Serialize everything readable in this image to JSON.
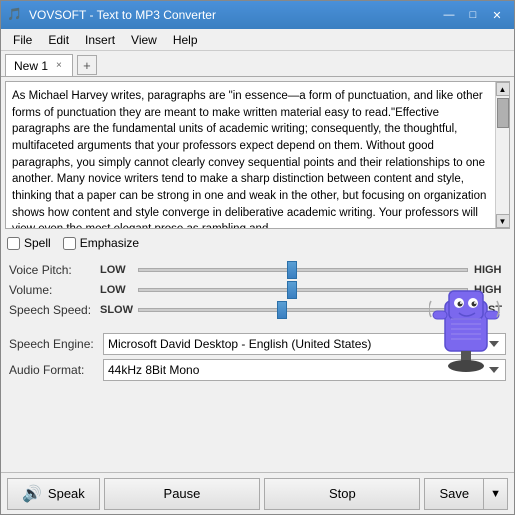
{
  "window": {
    "title": "VOVSOFT - Text to MP3 Converter",
    "icon": "🎵"
  },
  "titlebar": {
    "minimize_label": "—",
    "maximize_label": "□",
    "close_label": "✕"
  },
  "menu": {
    "items": [
      "File",
      "Edit",
      "Insert",
      "View",
      "Help"
    ]
  },
  "tab": {
    "name": "New 1",
    "close": "×",
    "add": "+"
  },
  "text_content": "As Michael Harvey writes, paragraphs are \"in essence—a form of punctuation, and like other forms of punctuation they are meant to make written material easy to read.\"Effective paragraphs are the fundamental units of academic writing; consequently, the thoughtful, multifaceted arguments that your professors expect depend on them. Without good paragraphs, you simply cannot clearly convey sequential points and their relationships to one another.\n\nMany novice writers tend to make a sharp distinction between content and style, thinking that a paper can be strong in one and weak in the other, but focusing on organization shows how content and style converge in deliberative academic writing. Your professors will view even the most elegant prose as rambling and",
  "checkboxes": {
    "spell_label": "Spell",
    "emphasize_label": "Emphasize"
  },
  "sliders": {
    "voice_pitch": {
      "label": "Voice Pitch:",
      "low": "LOW",
      "high": "HIGH",
      "position": 45
    },
    "volume": {
      "label": "Volume:",
      "low": "LOW",
      "high": "HIGH",
      "position": 45
    },
    "speech_speed": {
      "label": "Speech Speed:",
      "low": "SLOW",
      "high": "FAST",
      "position": 42
    }
  },
  "selects": {
    "speech_engine": {
      "label": "Speech Engine:",
      "value": "Microsoft David Desktop - English (United States)"
    },
    "audio_format": {
      "label": "Audio Format:",
      "value": "44kHz 8Bit Mono"
    }
  },
  "buttons": {
    "speak": "Speak",
    "pause": "Pause",
    "stop": "Stop",
    "save": "Save"
  },
  "colors": {
    "accent": "#3a7fc1",
    "slider_thumb": "#3a7fc1"
  }
}
